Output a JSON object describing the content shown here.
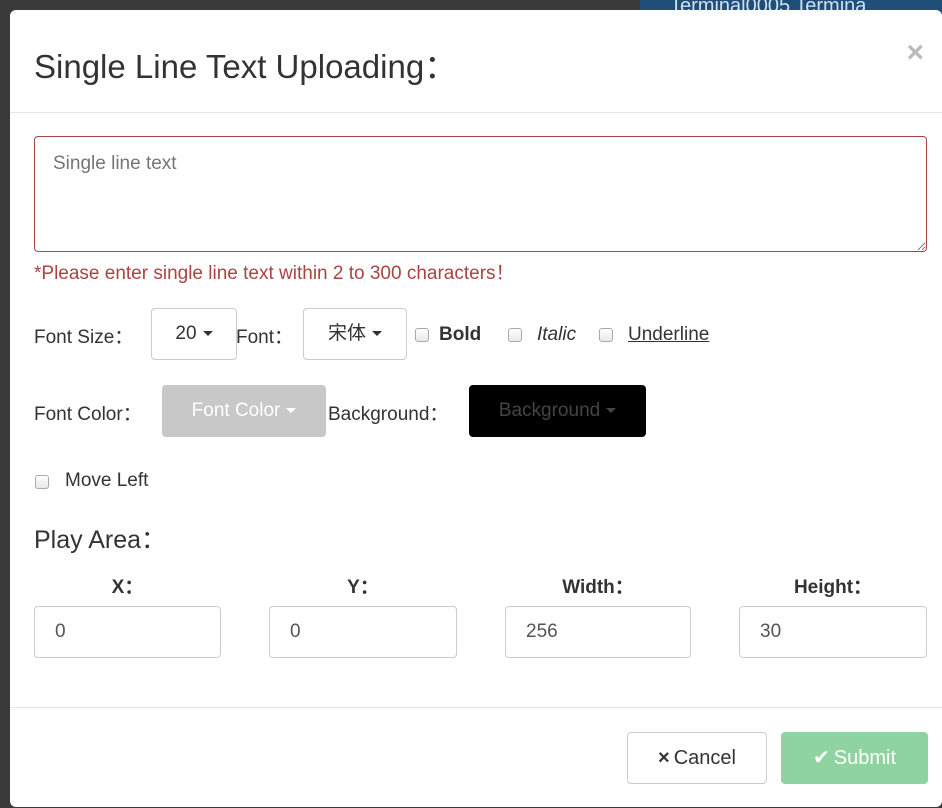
{
  "background": {
    "behind_text": "Terminal0005  Termina"
  },
  "dialog": {
    "title": "Single Line Text Uploading：",
    "close_glyph": "×",
    "text_placeholder": "Single line text",
    "help_text": "*Please enter single line text within 2 to 300 characters！",
    "font_size_label": "Font Size：",
    "font_size_value": "20",
    "font_label": "Font：",
    "font_value": "宋体",
    "bold_label": "Bold",
    "italic_label": "Italic",
    "underline_label": "Underline",
    "font_color_label": "Font Color：",
    "font_color_button": "Font Color",
    "background_label": "Background：",
    "background_button": "Background",
    "move_left_label": "Move Left",
    "play_area_title": "Play Area：",
    "x_label": "X：",
    "y_label": "Y：",
    "width_label": "Width：",
    "height_label": "Height：",
    "x_value": "0",
    "y_value": "0",
    "width_value": "256",
    "height_value": "30",
    "cancel_label": "Cancel",
    "submit_label": "Submit",
    "cancel_icon": "×",
    "submit_icon": "✔"
  },
  "colors": {
    "error": "#a94442",
    "font_color_btn": "#c8c8c8",
    "background_btn": "#000000",
    "submit_btn": "#8fd3a0"
  }
}
